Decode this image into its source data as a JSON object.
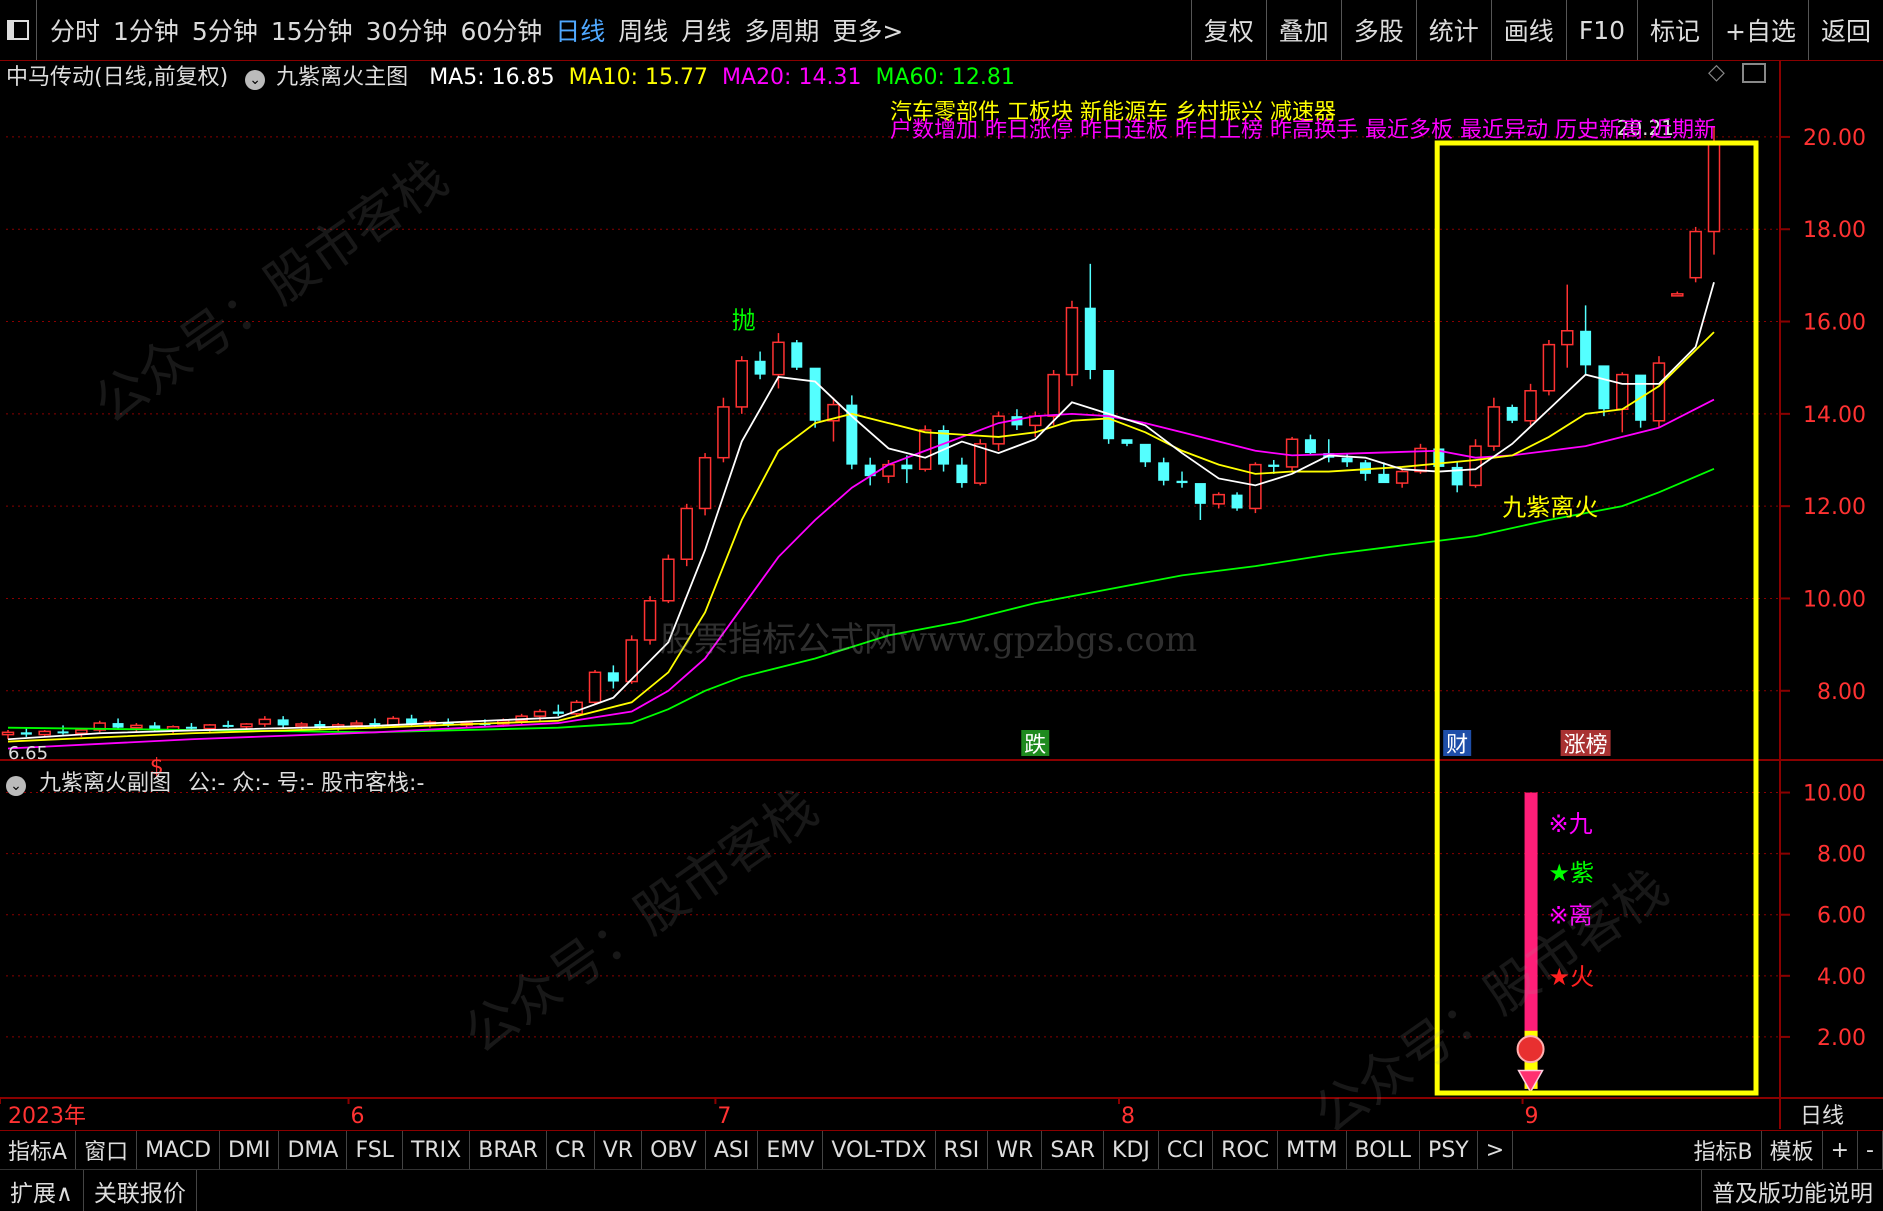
{
  "toolbar": {
    "window_icon": "window-icon",
    "periods": [
      "分时",
      "1分钟",
      "5分钟",
      "15分钟",
      "30分钟",
      "60分钟",
      "日线",
      "周线",
      "月线",
      "多周期",
      "更多>"
    ],
    "active_period": "日线",
    "right_buttons": [
      "复权",
      "叠加",
      "多股",
      "统计",
      "画线",
      "F10",
      "标记",
      "+自选",
      "返回"
    ]
  },
  "main_header": {
    "stock_title": "中马传动(日线,前复权)",
    "indicator_name": "九紫离火主图",
    "ma": [
      {
        "label": "MA5: 16.85",
        "color": "#ffffff"
      },
      {
        "label": "MA10: 15.77",
        "color": "#ffff00"
      },
      {
        "label": "MA20: 14.31",
        "color": "#ff00ff"
      },
      {
        "label": "MA60: 12.81",
        "color": "#00ff00"
      }
    ]
  },
  "concepts_line1": "汽车零部件 工板块 新能源车 乡村振兴 减速器",
  "concepts_line2": "户数增加 昨日涨停 昨日连板 昨日上榜 昨高换手 最近多板 最近异动 历史新高 近期新",
  "high_price_label": "20.21",
  "low_price_label": "6.65",
  "signal_labels": {
    "sell": "抛",
    "buy": "$",
    "indicator": "九紫离火"
  },
  "event_badges": [
    {
      "text": "跌",
      "color": "#1e8a1e"
    },
    {
      "text": "财",
      "color": "#1e4ea8"
    },
    {
      "text": "涨榜",
      "color": "#a83232"
    }
  ],
  "sub_header": {
    "indicator_name": "九紫离火副图",
    "fields": "公:-  众:-  号:-  股市客栈:-"
  },
  "sub_labels": [
    {
      "text": "※九",
      "color": "#ff00ff"
    },
    {
      "text": "★紫",
      "color": "#00ff00"
    },
    {
      "text": "※离",
      "color": "#ff00ff"
    },
    {
      "text": "★火",
      "color": "#ff2020"
    }
  ],
  "watermark_text": "股票指标公式网www.gpzbgs.com",
  "watermark_side": "公众号：股市客栈",
  "time_axis": {
    "labels": [
      "2023年",
      "6",
      "7",
      "8",
      "9"
    ],
    "period_label": "日线"
  },
  "indicator_tabs": [
    "指标A",
    "窗口",
    "MACD",
    "DMI",
    "DMA",
    "FSL",
    "TRIX",
    "BRAR",
    "CR",
    "VR",
    "OBV",
    "ASI",
    "EMV",
    "VOL-TDX",
    "RSI",
    "WR",
    "SAR",
    "KDJ",
    "CCI",
    "ROC",
    "MTM",
    "BOLL",
    "PSY",
    ">"
  ],
  "indicator_right": [
    "指标B",
    "模板",
    "+",
    "-"
  ],
  "status_bar": {
    "expand": "扩展∧",
    "related": "关联报价",
    "help": "普及版功能说明"
  },
  "colors": {
    "up": "#ff3232",
    "down": "#54ffff",
    "ma5": "#ffffff",
    "ma10": "#ffff00",
    "ma20": "#ff00ff",
    "ma60": "#00ff00",
    "highlight_box": "#ffff00",
    "grid": "#8a0000"
  },
  "chart_data": {
    "type": "candlestick",
    "main_panel": {
      "y_axis_ticks": [
        8,
        10,
        12,
        14,
        16,
        18,
        20
      ],
      "y_range": [
        6.5,
        20.8
      ],
      "candles": [
        [
          7.05,
          7.15,
          6.95,
          7.1
        ],
        [
          7.1,
          7.2,
          7.0,
          7.05
        ],
        [
          7.05,
          7.15,
          7.0,
          7.12
        ],
        [
          7.12,
          7.25,
          7.05,
          7.08
        ],
        [
          7.08,
          7.18,
          7.0,
          7.15
        ],
        [
          7.15,
          7.35,
          7.1,
          7.3
        ],
        [
          7.3,
          7.4,
          7.15,
          7.2
        ],
        [
          7.2,
          7.3,
          7.1,
          7.25
        ],
        [
          7.25,
          7.32,
          7.12,
          7.15
        ],
        [
          7.15,
          7.25,
          7.08,
          7.22
        ],
        [
          7.22,
          7.3,
          7.15,
          7.18
        ],
        [
          7.18,
          7.28,
          7.1,
          7.26
        ],
        [
          7.26,
          7.35,
          7.2,
          7.22
        ],
        [
          7.22,
          7.3,
          7.14,
          7.28
        ],
        [
          7.28,
          7.45,
          7.22,
          7.38
        ],
        [
          7.38,
          7.45,
          7.2,
          7.25
        ],
        [
          7.25,
          7.32,
          7.15,
          7.28
        ],
        [
          7.28,
          7.35,
          7.18,
          7.22
        ],
        [
          7.22,
          7.3,
          7.12,
          7.26
        ],
        [
          7.26,
          7.36,
          7.2,
          7.3
        ],
        [
          7.3,
          7.4,
          7.2,
          7.25
        ],
        [
          7.25,
          7.45,
          7.2,
          7.4
        ],
        [
          7.4,
          7.48,
          7.25,
          7.28
        ],
        [
          7.28,
          7.36,
          7.2,
          7.32
        ],
        [
          7.32,
          7.4,
          7.22,
          7.26
        ],
        [
          7.26,
          7.35,
          7.2,
          7.3
        ],
        [
          7.3,
          7.38,
          7.22,
          7.28
        ],
        [
          7.28,
          7.4,
          7.22,
          7.35
        ],
        [
          7.35,
          7.5,
          7.28,
          7.45
        ],
        [
          7.45,
          7.6,
          7.35,
          7.55
        ],
        [
          7.55,
          7.7,
          7.45,
          7.5
        ],
        [
          7.5,
          7.8,
          7.45,
          7.75
        ],
        [
          7.75,
          8.45,
          7.7,
          8.4
        ],
        [
          8.4,
          8.55,
          8.05,
          8.2
        ],
        [
          8.2,
          9.2,
          8.15,
          9.1
        ],
        [
          9.1,
          10.05,
          9.0,
          9.95
        ],
        [
          9.95,
          10.95,
          9.9,
          10.85
        ],
        [
          10.85,
          12.05,
          10.7,
          11.95
        ],
        [
          11.95,
          13.15,
          11.8,
          13.05
        ],
        [
          13.05,
          14.35,
          12.95,
          14.15
        ],
        [
          14.15,
          15.25,
          14.0,
          15.15
        ],
        [
          15.15,
          15.35,
          14.75,
          14.85
        ],
        [
          14.85,
          15.75,
          14.55,
          15.55
        ],
        [
          15.55,
          15.6,
          14.95,
          15.0
        ],
        [
          15.0,
          14.85,
          13.7,
          13.85
        ],
        [
          13.85,
          14.35,
          13.4,
          14.2
        ],
        [
          14.2,
          14.4,
          12.8,
          12.9
        ],
        [
          12.9,
          13.05,
          12.45,
          12.65
        ],
        [
          12.65,
          13.0,
          12.5,
          12.9
        ],
        [
          12.9,
          13.1,
          12.5,
          12.8
        ],
        [
          12.8,
          13.75,
          12.75,
          13.65
        ],
        [
          13.65,
          13.75,
          12.75,
          12.9
        ],
        [
          12.9,
          13.05,
          12.4,
          12.5
        ],
        [
          12.5,
          13.45,
          12.45,
          13.35
        ],
        [
          13.35,
          14.05,
          13.2,
          13.95
        ],
        [
          13.95,
          14.1,
          13.65,
          13.75
        ],
        [
          13.75,
          14.05,
          13.5,
          13.95
        ],
        [
          13.95,
          14.95,
          13.75,
          14.85
        ],
        [
          14.85,
          16.45,
          14.6,
          16.3
        ],
        [
          16.3,
          17.25,
          14.75,
          14.95
        ],
        [
          14.95,
          14.9,
          13.35,
          13.45
        ],
        [
          13.45,
          13.4,
          13.3,
          13.35
        ],
        [
          13.35,
          13.15,
          12.85,
          12.95
        ],
        [
          12.95,
          13.05,
          12.45,
          12.55
        ],
        [
          12.55,
          12.75,
          12.4,
          12.5
        ],
        [
          12.5,
          12.35,
          11.7,
          12.05
        ],
        [
          12.05,
          12.3,
          11.95,
          12.25
        ],
        [
          12.25,
          12.3,
          11.9,
          11.95
        ],
        [
          11.95,
          12.95,
          11.85,
          12.9
        ],
        [
          12.9,
          13.0,
          12.7,
          12.85
        ],
        [
          12.85,
          13.5,
          12.75,
          13.45
        ],
        [
          13.45,
          13.55,
          13.1,
          13.15
        ],
        [
          13.15,
          13.45,
          12.95,
          13.05
        ],
        [
          13.05,
          13.15,
          12.85,
          12.95
        ],
        [
          12.95,
          13.0,
          12.55,
          12.7
        ],
        [
          12.7,
          12.95,
          12.55,
          12.5
        ],
        [
          12.5,
          12.8,
          12.4,
          12.75
        ],
        [
          12.75,
          13.35,
          12.7,
          13.25
        ],
        [
          13.25,
          13.55,
          12.75,
          12.85
        ],
        [
          12.85,
          12.95,
          12.3,
          12.45
        ],
        [
          12.45,
          13.45,
          12.4,
          13.3
        ],
        [
          13.3,
          14.35,
          13.2,
          14.15
        ],
        [
          14.15,
          14.2,
          13.8,
          13.85
        ],
        [
          13.85,
          14.65,
          13.75,
          14.5
        ],
        [
          14.5,
          15.6,
          14.4,
          15.5
        ],
        [
          15.5,
          16.8,
          15.0,
          15.8
        ],
        [
          15.8,
          16.35,
          14.85,
          15.05
        ],
        [
          15.05,
          14.85,
          13.95,
          14.1
        ],
        [
          14.1,
          14.9,
          13.6,
          14.85
        ],
        [
          14.85,
          14.6,
          13.7,
          13.85
        ],
        [
          13.85,
          15.25,
          13.7,
          15.1
        ],
        [
          16.6,
          16.65,
          16.55,
          16.6
        ],
        [
          16.95,
          18.05,
          16.85,
          17.95
        ],
        [
          17.95,
          20.21,
          17.45,
          19.85
        ]
      ],
      "ma5": [
        [
          0,
          6.95
        ],
        [
          5,
          7.08
        ],
        [
          10,
          7.14
        ],
        [
          20,
          7.24
        ],
        [
          30,
          7.42
        ],
        [
          33,
          7.85
        ],
        [
          36,
          9.05
        ],
        [
          38,
          11.05
        ],
        [
          40,
          13.4
        ],
        [
          42,
          14.8
        ],
        [
          44,
          14.7
        ],
        [
          46,
          13.95
        ],
        [
          48,
          13.25
        ],
        [
          50,
          13.05
        ],
        [
          52,
          13.4
        ],
        [
          54,
          13.15
        ],
        [
          56,
          13.45
        ],
        [
          58,
          14.25
        ],
        [
          60,
          14.0
        ],
        [
          62,
          13.75
        ],
        [
          64,
          13.15
        ],
        [
          66,
          12.6
        ],
        [
          68,
          12.45
        ],
        [
          70,
          12.7
        ],
        [
          72,
          13.1
        ],
        [
          74,
          13.05
        ],
        [
          76,
          12.8
        ],
        [
          78,
          12.75
        ],
        [
          80,
          12.8
        ],
        [
          82,
          13.35
        ],
        [
          84,
          14.1
        ],
        [
          86,
          14.85
        ],
        [
          88,
          14.65
        ],
        [
          90,
          14.65
        ],
        [
          92,
          15.45
        ],
        [
          93,
          16.85
        ]
      ],
      "ma10": [
        [
          0,
          6.9
        ],
        [
          10,
          7.08
        ],
        [
          20,
          7.2
        ],
        [
          30,
          7.35
        ],
        [
          34,
          7.75
        ],
        [
          36,
          8.4
        ],
        [
          38,
          9.7
        ],
        [
          40,
          11.7
        ],
        [
          42,
          13.2
        ],
        [
          44,
          13.8
        ],
        [
          46,
          14.0
        ],
        [
          48,
          13.8
        ],
        [
          50,
          13.6
        ],
        [
          52,
          13.55
        ],
        [
          54,
          13.5
        ],
        [
          56,
          13.6
        ],
        [
          58,
          13.85
        ],
        [
          60,
          13.9
        ],
        [
          62,
          13.6
        ],
        [
          64,
          13.2
        ],
        [
          66,
          12.9
        ],
        [
          68,
          12.7
        ],
        [
          70,
          12.75
        ],
        [
          72,
          12.75
        ],
        [
          76,
          12.85
        ],
        [
          80,
          13.0
        ],
        [
          82,
          13.1
        ],
        [
          84,
          13.5
        ],
        [
          86,
          14.0
        ],
        [
          88,
          14.1
        ],
        [
          90,
          14.6
        ],
        [
          93,
          15.77
        ]
      ],
      "ma20": [
        [
          0,
          6.75
        ],
        [
          10,
          6.95
        ],
        [
          20,
          7.1
        ],
        [
          30,
          7.3
        ],
        [
          34,
          7.55
        ],
        [
          36,
          8.0
        ],
        [
          38,
          8.7
        ],
        [
          40,
          9.8
        ],
        [
          42,
          10.9
        ],
        [
          44,
          11.7
        ],
        [
          46,
          12.4
        ],
        [
          48,
          12.9
        ],
        [
          50,
          13.2
        ],
        [
          52,
          13.5
        ],
        [
          54,
          13.8
        ],
        [
          56,
          13.95
        ],
        [
          58,
          14.0
        ],
        [
          60,
          13.95
        ],
        [
          62,
          13.8
        ],
        [
          64,
          13.6
        ],
        [
          66,
          13.4
        ],
        [
          68,
          13.2
        ],
        [
          70,
          13.1
        ],
        [
          74,
          13.15
        ],
        [
          78,
          13.2
        ],
        [
          80,
          13.05
        ],
        [
          82,
          13.1
        ],
        [
          86,
          13.3
        ],
        [
          88,
          13.5
        ],
        [
          90,
          13.7
        ],
        [
          93,
          14.31
        ]
      ],
      "ma60": [
        [
          0,
          7.2
        ],
        [
          10,
          7.15
        ],
        [
          20,
          7.1
        ],
        [
          30,
          7.2
        ],
        [
          34,
          7.3
        ],
        [
          36,
          7.6
        ],
        [
          38,
          8.0
        ],
        [
          40,
          8.3
        ],
        [
          44,
          8.7
        ],
        [
          48,
          9.2
        ],
        [
          52,
          9.5
        ],
        [
          56,
          9.9
        ],
        [
          60,
          10.2
        ],
        [
          64,
          10.5
        ],
        [
          68,
          10.7
        ],
        [
          72,
          10.95
        ],
        [
          76,
          11.15
        ],
        [
          80,
          11.35
        ],
        [
          84,
          11.7
        ],
        [
          88,
          12.0
        ],
        [
          90,
          12.3
        ],
        [
          93,
          12.81
        ]
      ]
    },
    "sub_panel": {
      "y_axis_ticks": [
        2,
        4,
        6,
        8,
        10
      ],
      "y_range": [
        0,
        11
      ],
      "bar": {
        "index": 83,
        "from": 0.3,
        "to": 10.0,
        "yellow_to": 2.2
      },
      "markers": [
        {
          "type": "ball",
          "value": 1.6
        },
        {
          "type": "gem",
          "value": 0.7
        }
      ]
    },
    "highlight_box": {
      "from_index": 79,
      "to_index": 93
    },
    "x_axis_labels": [
      {
        "text": "2023年",
        "index": 0
      },
      {
        "text": "6",
        "index": 19
      },
      {
        "text": "7",
        "index": 39
      },
      {
        "text": "8",
        "index": 61
      },
      {
        "text": "9",
        "index": 83
      }
    ]
  }
}
